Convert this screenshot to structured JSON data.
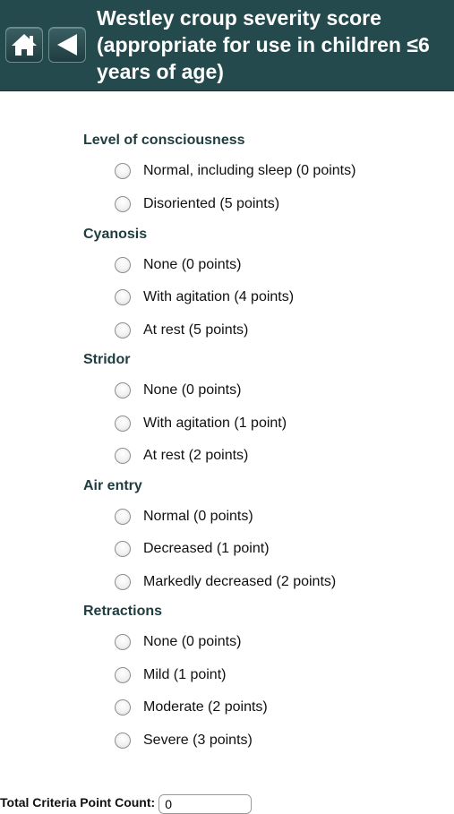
{
  "header": {
    "title": "Westley croup severity score (appropriate for use in children ≤6 years of age)",
    "home_icon": "home-icon",
    "back_icon": "back-arrow-icon",
    "color": "#244a4d"
  },
  "sections": [
    {
      "title": "Level of consciousness",
      "options": [
        "Normal, including sleep (0 points)",
        "Disoriented (5 points)"
      ]
    },
    {
      "title": "Cyanosis",
      "options": [
        "None (0 points)",
        "With agitation (4 points)",
        "At rest (5 points)"
      ]
    },
    {
      "title": "Stridor",
      "options": [
        "None (0 points)",
        "With agitation (1 point)",
        "At rest (2 points)"
      ]
    },
    {
      "title": "Air entry",
      "options": [
        "Normal (0 points)",
        "Decreased (1 point)",
        "Markedly decreased (2 points)"
      ]
    },
    {
      "title": "Retractions",
      "options": [
        "None (0 points)",
        "Mild (1 point)",
        "Moderate (2 points)",
        "Severe (3 points)"
      ]
    }
  ],
  "total": {
    "label": "Total Criteria Point Count:",
    "value": "0"
  }
}
